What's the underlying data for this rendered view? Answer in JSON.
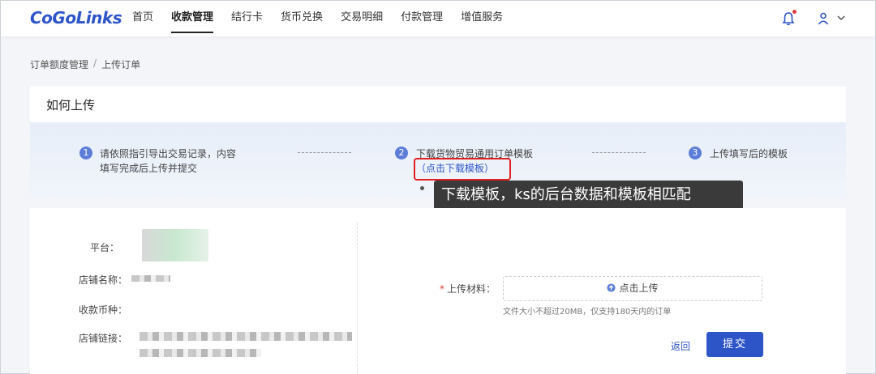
{
  "brand": {
    "logo_text": "CoGoLinks",
    "accent": "#2e55c8"
  },
  "nav": {
    "items": [
      {
        "label": "首页",
        "active": false
      },
      {
        "label": "收款管理",
        "active": true
      },
      {
        "label": "结行卡",
        "active": false
      },
      {
        "label": "货币兑换",
        "active": false
      },
      {
        "label": "交易明细",
        "active": false
      },
      {
        "label": "付款管理",
        "active": false
      },
      {
        "label": "增值服务",
        "active": false
      }
    ],
    "icons": [
      "bell-icon",
      "user-icon",
      "chevron-down-icon"
    ]
  },
  "breadcrumb": {
    "parent": "订单额度管理",
    "separator": "/",
    "current": "上传订单"
  },
  "guide": {
    "title": "如何上传",
    "steps": [
      {
        "num": "1",
        "line1": "请依照指引导出交易记录，内容",
        "line2": "填写完成后上传并提交"
      },
      {
        "num": "2",
        "line1": "下载货物贸易通用订单模板",
        "link": "（点击下载模板）"
      },
      {
        "num": "3",
        "line1": "上传填写后的模板"
      }
    ]
  },
  "annotation": {
    "tooltip": "下载模板，ks的后台数据和模板相匹配",
    "highlight_color": "#e02020"
  },
  "form": {
    "labels": {
      "platform": "平台：",
      "store_name": "店铺名称：",
      "currency": "收款币种：",
      "store_link": "店铺链接："
    },
    "upload": {
      "label": "上传材料：",
      "required_mark": "*",
      "button": "点击上传",
      "hint": "文件大小不超过20MB，仅支持180天内的订单"
    },
    "back": "返回",
    "submit": "提交"
  }
}
